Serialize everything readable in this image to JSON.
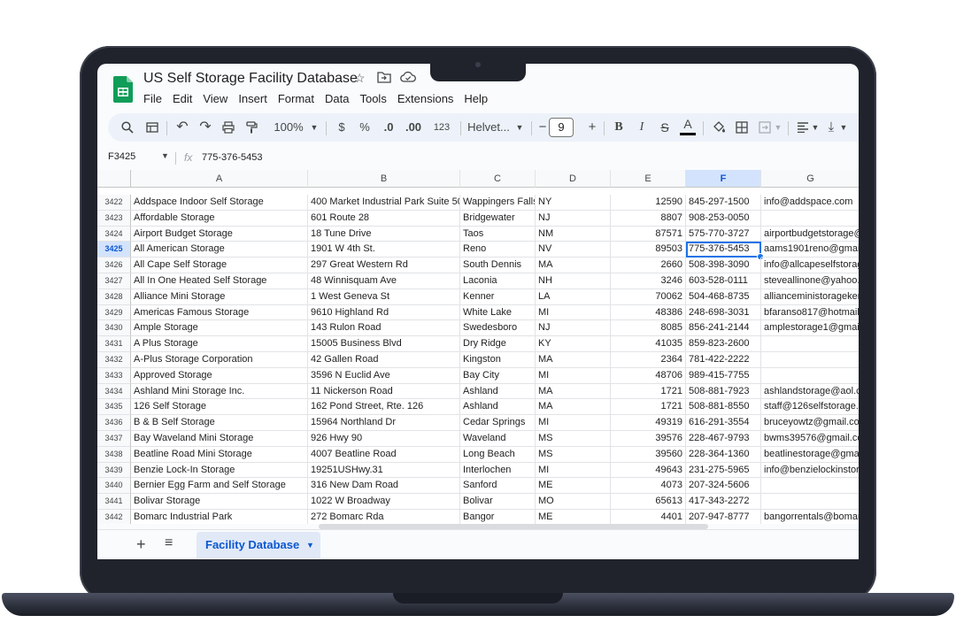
{
  "doc": {
    "title": "US Self Storage Facility Database"
  },
  "menu": [
    "File",
    "Edit",
    "View",
    "Insert",
    "Format",
    "Data",
    "Tools",
    "Extensions",
    "Help"
  ],
  "toolbar": {
    "zoom": "100%",
    "currency": "$",
    "percent": "%",
    "dec_less": ".0",
    "dec_more": ".00",
    "num_format": "123",
    "font": "Helvet...",
    "font_size": "9",
    "minus": "−",
    "plus": "+",
    "bold": "B",
    "italic": "I",
    "strike": "S",
    "text_color": "A"
  },
  "formula_bar": {
    "name_box": "F3425",
    "fx": "fx",
    "value": "775-376-5453"
  },
  "columns": [
    "A",
    "B",
    "C",
    "D",
    "E",
    "F",
    "G"
  ],
  "selected_cell": {
    "row": "3425",
    "col": "F"
  },
  "rows": [
    {
      "n": "3422",
      "a": "Addspace Indoor Self Storage",
      "b": "400 Market Industrial Park Suite 50",
      "c": "Wappingers Falls",
      "d": "NY",
      "e": "12590",
      "f": "845-297-1500",
      "g": "info@addspace.com"
    },
    {
      "n": "3423",
      "a": "Affordable Storage",
      "b": "601 Route 28",
      "c": "Bridgewater",
      "d": "NJ",
      "e": "8807",
      "f": "908-253-0050",
      "g": ""
    },
    {
      "n": "3424",
      "a": "Airport Budget Storage",
      "b": "18 Tune Drive",
      "c": "Taos",
      "d": "NM",
      "e": "87571",
      "f": "575-770-3727",
      "g": "airportbudgetstorage@y"
    },
    {
      "n": "3425",
      "a": "All American Storage",
      "b": "1901 W 4th St.",
      "c": "Reno",
      "d": "NV",
      "e": "89503",
      "f": "775-376-5453",
      "g": "aams1901reno@gmail.c"
    },
    {
      "n": "3426",
      "a": "All Cape Self Storage",
      "b": "297 Great Western Rd",
      "c": "South Dennis",
      "d": "MA",
      "e": "2660",
      "f": "508-398-3090",
      "g": "info@allcapeselfstorage"
    },
    {
      "n": "3427",
      "a": "All In One Heated Self Storage",
      "b": "48 Winnisquam Ave",
      "c": "Laconia",
      "d": "NH",
      "e": "3246",
      "f": "603-528-0111",
      "g": "steveallinone@yahoo.co"
    },
    {
      "n": "3428",
      "a": "Alliance Mini Storage",
      "b": "1 West Geneva St",
      "c": "Kenner",
      "d": "LA",
      "e": "70062",
      "f": "504-468-8735",
      "g": "allianceministoragekenr"
    },
    {
      "n": "3429",
      "a": "Americas Famous Storage",
      "b": "9610 Highland Rd",
      "c": "White Lake",
      "d": "MI",
      "e": "48386",
      "f": "248-698-3031",
      "g": "bfaranso817@hotmail.c"
    },
    {
      "n": "3430",
      "a": "Ample Storage",
      "b": "143 Rulon Road",
      "c": "Swedesboro",
      "d": "NJ",
      "e": "8085",
      "f": "856-241-2144",
      "g": "amplestorage1@gmail.c"
    },
    {
      "n": "3431",
      "a": "A Plus Storage",
      "b": "15005 Business Blvd",
      "c": "Dry Ridge",
      "d": "KY",
      "e": "41035",
      "f": "859-823-2600",
      "g": ""
    },
    {
      "n": "3432",
      "a": "A-Plus Storage Corporation",
      "b": "42 Gallen Road",
      "c": "Kingston",
      "d": "MA",
      "e": "2364",
      "f": "781-422-2222",
      "g": ""
    },
    {
      "n": "3433",
      "a": "Approved Storage",
      "b": "3596 N Euclid Ave",
      "c": "Bay City",
      "d": "MI",
      "e": "48706",
      "f": "989-415-7755",
      "g": ""
    },
    {
      "n": "3434",
      "a": "Ashland Mini Storage Inc.",
      "b": "11 Nickerson Road",
      "c": "Ashland",
      "d": "MA",
      "e": "1721",
      "f": "508-881-7923",
      "g": "ashlandstorage@aol.co"
    },
    {
      "n": "3435",
      "a": "126 Self Storage",
      "b": "162 Pond Street, Rte. 126",
      "c": "Ashland",
      "d": "MA",
      "e": "1721",
      "f": "508-881-8550",
      "g": "staff@126selfstorage.co"
    },
    {
      "n": "3436",
      "a": "B & B Self Storage",
      "b": "15964 Northland Dr",
      "c": "Cedar Springs",
      "d": "MI",
      "e": "49319",
      "f": "616-291-3554",
      "g": "bruceyowtz@gmail.com"
    },
    {
      "n": "3437",
      "a": "Bay Waveland Mini Storage",
      "b": "926 Hwy 90",
      "c": "Waveland",
      "d": "MS",
      "e": "39576",
      "f": "228-467-9793",
      "g": "bwms39576@gmail.com"
    },
    {
      "n": "3438",
      "a": "Beatline Road Mini Storage",
      "b": "4007 Beatline Road",
      "c": "Long Beach",
      "d": "MS",
      "e": "39560",
      "f": "228-364-1360",
      "g": "beatlinestorage@gmail."
    },
    {
      "n": "3439",
      "a": "Benzie Lock-In Storage",
      "b": "19251USHwy.31",
      "c": "Interlochen",
      "d": "MI",
      "e": "49643",
      "f": "231-275-5965",
      "g": "info@benzielockinstorag"
    },
    {
      "n": "3440",
      "a": "Bernier Egg Farm and Self Storage",
      "b": "316 New Dam Road",
      "c": "Sanford",
      "d": "ME",
      "e": "4073",
      "f": "207-324-5606",
      "g": ""
    },
    {
      "n": "3441",
      "a": "Bolivar Storage",
      "b": "1022 W Broadway",
      "c": "Bolivar",
      "d": "MO",
      "e": "65613",
      "f": "417-343-2272",
      "g": ""
    },
    {
      "n": "3442",
      "a": "Bomarc Industrial Park",
      "b": "272 Bomarc Rda",
      "c": "Bangor",
      "d": "ME",
      "e": "4401",
      "f": "207-947-8777",
      "g": "bangorrentals@bomarc"
    }
  ],
  "sheet_tab": {
    "name": "Facility Database"
  }
}
